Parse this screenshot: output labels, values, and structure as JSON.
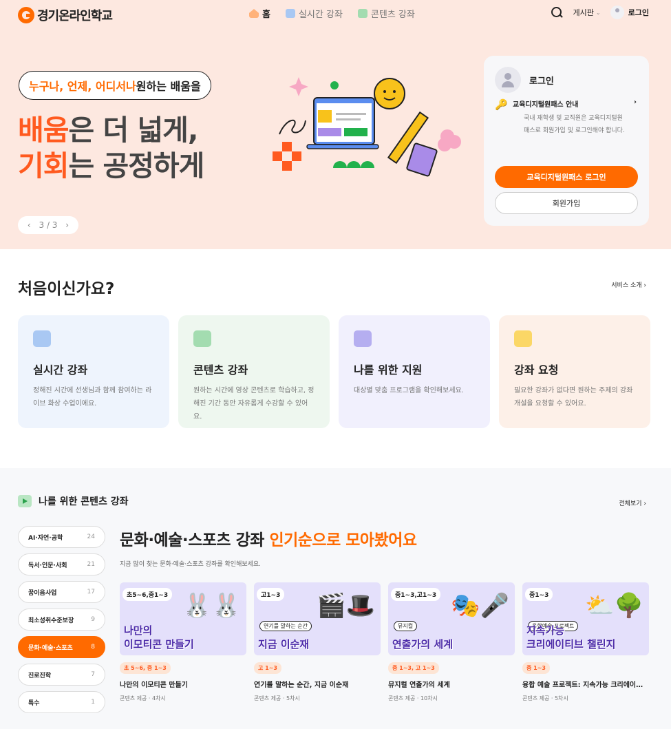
{
  "header": {
    "logo": "경기온라인학교",
    "nav": [
      {
        "label": "홈",
        "icon": "home-icon"
      },
      {
        "label": "실시간 강좌",
        "icon": "live-icon"
      },
      {
        "label": "콘텐츠 강좌",
        "icon": "content-icon"
      }
    ],
    "board": "게시판",
    "login": "로그인"
  },
  "hero": {
    "bubble_prefix": "누구나, 언제, 어디서나",
    "bubble_suffix": " 원하는 배움을",
    "line1_accent": "배움",
    "line1_rest": "은 더 넓게,",
    "line2_accent": "기회",
    "line2_rest": "는 공정하게",
    "pager": "3 / 3"
  },
  "login_card": {
    "title": "로그인",
    "info_title": "교육디지털원패스 안내",
    "info_desc": "국내 재학생 및 교직원은 교육디지털원패스로 회원가입 및 로그인해야 합니다.",
    "primary_button": "교육디지털원패스 로그인",
    "secondary_button": "회원가입"
  },
  "intro": {
    "title": "처음이신가요?",
    "more": "서비스 소개",
    "cards": [
      {
        "title": "실시간 강좌",
        "desc": "정해진 시간에 선생님과 함께 참여하는 라이브 화상 수업이에요.",
        "bg": "#eef4fd",
        "icon_bg": "#a9c8f3",
        "icon": "live-class-icon"
      },
      {
        "title": "콘텐츠 강좌",
        "desc": "원하는 시간에 영상 콘텐츠로 학습하고, 정해진 기간 동안 자유롭게 수강할 수 있어요.",
        "bg": "#eef7ef",
        "icon_bg": "#a3dcb0",
        "icon": "video-icon"
      },
      {
        "title": "나를 위한 지원",
        "desc": "대상별 맞춤 프로그램을 확인해보세요.",
        "bg": "#f1f0fd",
        "icon_bg": "#b5aef0",
        "icon": "bookmark-icon"
      },
      {
        "title": "강좌 요청",
        "desc": "필요한 강좌가 없다면 원하는 주제의 강좌 개설을 요청할 수 있어요.",
        "bg": "#fdf0e8",
        "icon_bg": "#fbd766",
        "icon": "clipboard-icon"
      }
    ]
  },
  "content_section": {
    "title": "나를 위한 콘텐츠 강좌",
    "more": "전체보기",
    "categories": [
      {
        "label": "AI·자연·공학",
        "count": "24",
        "active": false
      },
      {
        "label": "독서·인문·사회",
        "count": "21",
        "active": false
      },
      {
        "label": "꿈이음사업",
        "count": "17",
        "active": false
      },
      {
        "label": "최소성취수준보장",
        "count": "9",
        "active": false
      },
      {
        "label": "문화·예술·스포츠",
        "count": "8",
        "active": true
      },
      {
        "label": "진로진학",
        "count": "7",
        "active": false
      },
      {
        "label": "특수",
        "count": "1",
        "active": false
      }
    ],
    "headline_main": "문화·예술·스포츠 강좌 ",
    "headline_accent": "인기순으로 모아봤어요",
    "subtitle": "지금 많이 찾는 문화·예술·스포츠 강좌를 확인해보세요.",
    "courses": [
      {
        "tag": "초5~6,중1~3",
        "small": "",
        "big1": "나만의",
        "big2": "이모티콘 만들기",
        "deco": "🐰🐰",
        "badge": "초 5~6, 중 1~3",
        "name": "나만의 이모티콘 만들기",
        "meta": "콘텐츠 제공 · 4차시"
      },
      {
        "tag": "고1~3",
        "small": "연기를 말하는 순간",
        "big1": "",
        "big2": "지금 이순재",
        "deco": "🎬🎩",
        "badge": "고 1~3",
        "name": "연기를 말하는 순간, 지금 이순재",
        "meta": "콘텐츠 제공 · 5차시"
      },
      {
        "tag": "중1~3,고1~3",
        "small": "뮤지컬",
        "big1": "",
        "big2": "연출가의 세계",
        "deco": "🎭🎤",
        "badge": "중 1~3, 고 1~3",
        "name": "뮤지컬 연출가의 세계",
        "meta": "콘텐츠 제공 · 10차시"
      },
      {
        "tag": "중1~3",
        "small": "융합예술 프로젝트",
        "big1": "지속가능",
        "big2": "크리에이티브 챌린지",
        "deco": "⛅🌳",
        "badge": "중 1~3",
        "name": "융합 예술 프로젝트: 지속가능 크리에이티브 챌린지",
        "meta": "콘텐츠 제공 · 5차시"
      }
    ]
  }
}
